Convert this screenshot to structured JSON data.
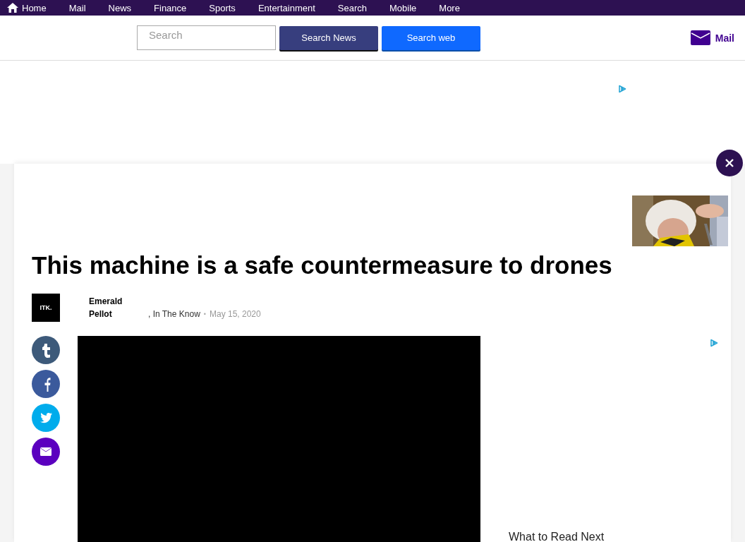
{
  "nav": {
    "items": [
      {
        "label": "Home",
        "kind": "home"
      },
      {
        "label": "Mail",
        "kind": "link"
      },
      {
        "label": "News",
        "kind": "link"
      },
      {
        "label": "Finance",
        "kind": "link"
      },
      {
        "label": "Sports",
        "kind": "link"
      },
      {
        "label": "Entertainment",
        "kind": "link"
      },
      {
        "label": "Search",
        "kind": "link"
      },
      {
        "label": "Mobile",
        "kind": "link"
      },
      {
        "label": "More",
        "kind": "link"
      }
    ]
  },
  "header": {
    "search": {
      "placeholder": "Search"
    },
    "buttons": [
      {
        "label": "Search News",
        "kind": "news"
      },
      {
        "label": "Search web",
        "kind": "web"
      }
    ],
    "mail": {
      "label": "Mail"
    }
  },
  "article": {
    "title": "This machine is a safe countermeasure to drones",
    "source_logo": "ITK.",
    "author": "Emerald Pellot",
    "publisher": ", In The Know",
    "separator": "•",
    "date": "May 15, 2020",
    "share": [
      {
        "kind": "tumblr"
      },
      {
        "kind": "facebook"
      },
      {
        "kind": "twitter"
      },
      {
        "kind": "email"
      }
    ],
    "aside": {
      "heading": "What to Read Next"
    }
  }
}
